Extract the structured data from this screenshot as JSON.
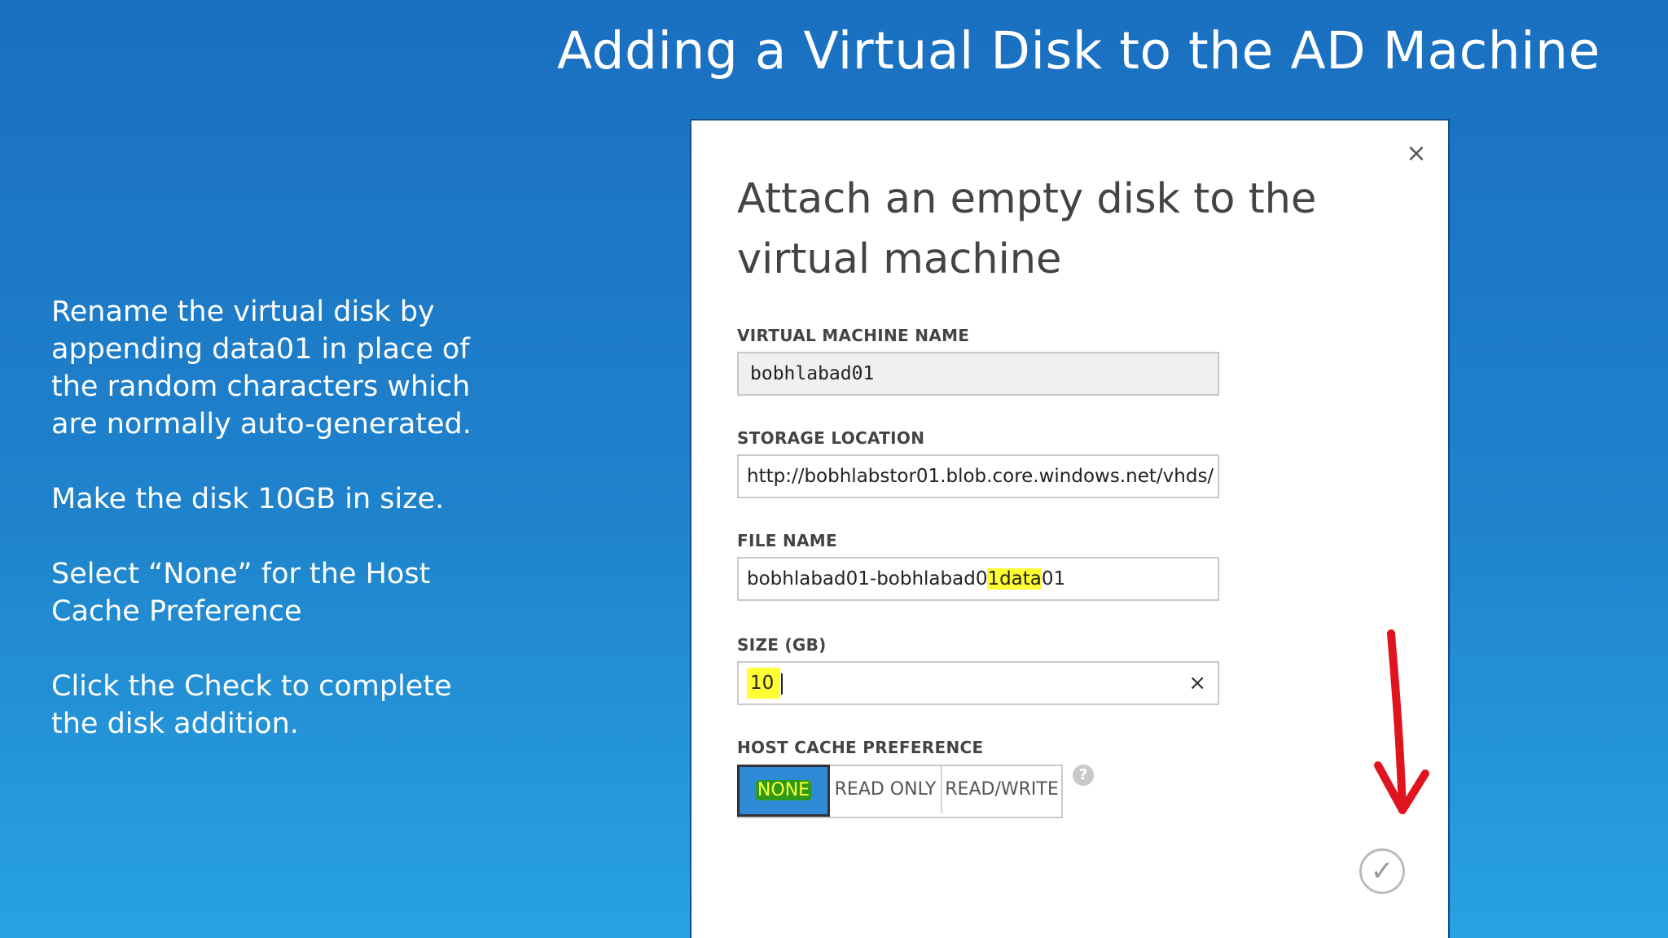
{
  "slide": {
    "title": "Adding a Virtual Disk to the AD Machine",
    "notes": [
      "Rename the virtual disk by appending data01 in place of the random characters which are normally auto-generated.",
      "Make the disk 10GB in size.",
      "Select “None” for the Host Cache Preference",
      "Click the Check to complete the disk addition."
    ]
  },
  "dialog": {
    "title": "Attach an empty disk to the virtual machine",
    "vm_name": {
      "label": "VIRTUAL MACHINE NAME",
      "value": "bobhlabad01"
    },
    "storage": {
      "label": "STORAGE LOCATION",
      "value": "http://bobhlabstor01.blob.core.windows.net/vhds/"
    },
    "file_name": {
      "label": "FILE NAME",
      "value_prefix": "bobhlabad01-bobhlabad0",
      "value_highlight": "1data",
      "value_suffix": "01"
    },
    "size": {
      "label": "SIZE (GB)",
      "value": "10"
    },
    "host_cache": {
      "label": "HOST CACHE PREFERENCE",
      "options": [
        "NONE",
        "READ ONLY",
        "READ/WRITE"
      ],
      "selected": "NONE"
    },
    "help_glyph": "?",
    "close_glyph": "×",
    "clear_glyph": "×",
    "check_glyph": "✓"
  },
  "colors": {
    "highlight": "#ffff33",
    "selected_option": "#2e8ad6",
    "arrow": "#e0141e"
  },
  "icons": [
    "close-icon",
    "clear-icon",
    "help-icon",
    "checkmark-icon",
    "red-arrow-annotation"
  ]
}
